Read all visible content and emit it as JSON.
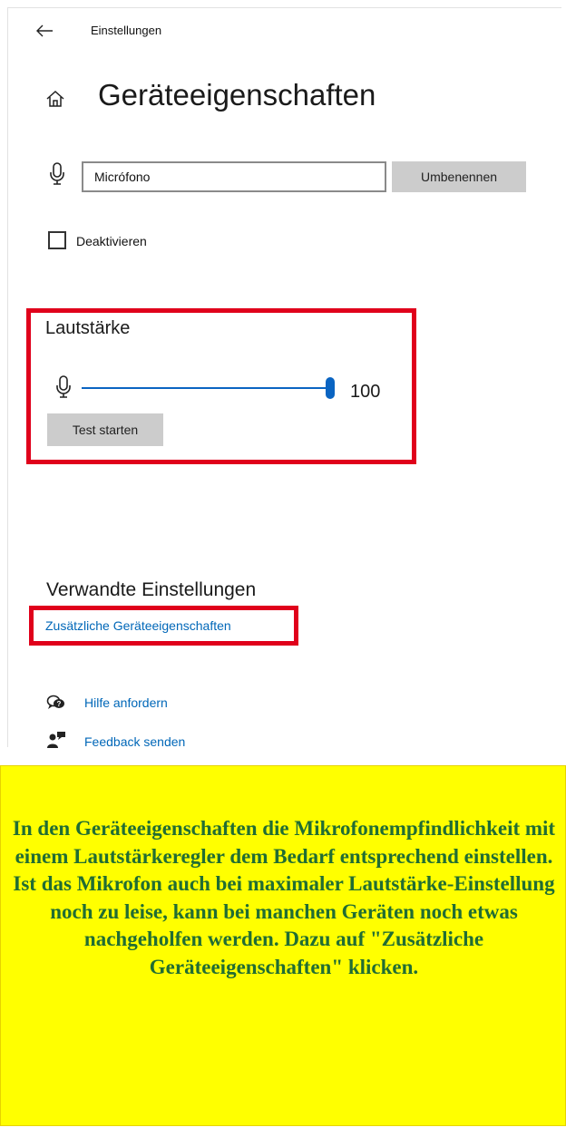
{
  "app": {
    "title": "Einstellungen"
  },
  "page": {
    "title": "Geräteeigenschaften"
  },
  "device": {
    "name_value": "Micrófono",
    "rename_label": "Umbenennen"
  },
  "disable": {
    "label": "Deaktivieren",
    "checked": false
  },
  "volume": {
    "heading": "Lautstärke",
    "value": 100,
    "max": 100,
    "test_label": "Test starten"
  },
  "related": {
    "heading": "Verwandte Einstellungen",
    "link_label": "Zusätzliche Geräteeigenschaften"
  },
  "support": {
    "help_label": "Hilfe anfordern",
    "feedback_label": "Feedback senden"
  },
  "note": {
    "text": "In den Geräteeigenschaften die Mikrofonempfindlichkeit mit einem Lautstärkeregler dem Bedarf entsprechend einstellen. Ist das Mikrofon auch bei maximaler Lautstärke-Einstellung noch zu leise, kann bei manchen Geräten noch etwas nachgeholfen werden. Dazu auf \"Zusätzliche Geräteeigenschaften\" klicken."
  },
  "colors": {
    "accent": "#0a64c2",
    "link": "#0067b8",
    "highlight_box": "#e0001b",
    "note_bg": "#ffff00",
    "note_text": "#216d33"
  },
  "icons": {
    "back": "arrow-left-icon",
    "home": "home-icon",
    "mic": "microphone-icon",
    "help": "help-chat-icon",
    "feedback": "feedback-icon"
  }
}
